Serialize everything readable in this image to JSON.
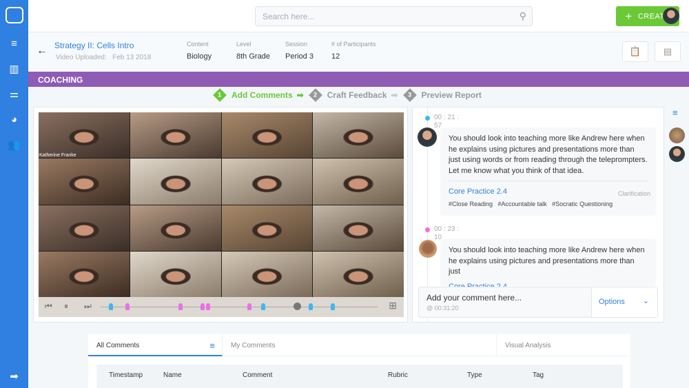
{
  "topbar": {
    "search_placeholder": "Search here...",
    "create_label": "CREATE"
  },
  "sidebar": {
    "icons": [
      "filter-icon",
      "bar-chart-icon",
      "sliders-icon",
      "pie-chart-icon",
      "users-icon"
    ],
    "collapse_icon": "arrow-right-icon"
  },
  "header": {
    "title": "Strategy II: Cells Intro",
    "uploaded_label": "Video Uploaded:",
    "uploaded_date": "Feb 13 2018",
    "meta": [
      {
        "label": "Content",
        "value": "Biology"
      },
      {
        "label": "Level",
        "value": "8th Grade"
      },
      {
        "label": "Session",
        "value": "Period 3"
      },
      {
        "label": "# of Participants",
        "value": "12"
      }
    ]
  },
  "banner": "COACHING",
  "steps": [
    {
      "num": "1",
      "label": "Add Comments",
      "active": true
    },
    {
      "num": "2",
      "label": "Craft Feedback"
    },
    {
      "num": "3",
      "label": "Preview Report"
    }
  ],
  "video": {
    "participant_name": "Katherine Franke",
    "progress": 0.71,
    "markers": [
      {
        "pos": 0.03,
        "color": "#3eb6f0"
      },
      {
        "pos": 0.09,
        "color": "#f06ce8"
      },
      {
        "pos": 0.28,
        "color": "#f06ce8"
      },
      {
        "pos": 0.36,
        "color": "#f06ce8"
      },
      {
        "pos": 0.38,
        "color": "#f06ce8"
      },
      {
        "pos": 0.53,
        "color": "#f06ce8"
      },
      {
        "pos": 0.58,
        "color": "#3eb6f0"
      },
      {
        "pos": 0.75,
        "color": "#3eb6f0"
      },
      {
        "pos": 0.83,
        "color": "#3eb6f0"
      }
    ]
  },
  "comments": [
    {
      "time": "00 : 21 : 57",
      "dot": "#3eb6f0",
      "text": "You should look into teaching more like Andrew here when he explains using pictures and presentations more than just using words or from reading through the teleprompters. Let me know what you think of that idea.",
      "practice": "Core Practice 2.4",
      "type": "Clarification",
      "tags": "#Close Reading   #Accountable talk   #Socratic Questioning"
    },
    {
      "time": "00 : 23 : 10",
      "dot": "#f06ce8",
      "text": "You should look into teaching more like Andrew here when he explains using pictures and presentations more than just",
      "practice": "Core Practice 2.4"
    }
  ],
  "add_comment": {
    "placeholder": "Add your comment here...",
    "time": "@ 00:31:20",
    "options_label": "Options"
  },
  "bottom": {
    "tabs": [
      "All Comments",
      "My Comments",
      "Visual Analysis"
    ],
    "columns": [
      "Timestamp",
      "Name",
      "Comment",
      "Rubric",
      "Type",
      "Tag"
    ]
  }
}
